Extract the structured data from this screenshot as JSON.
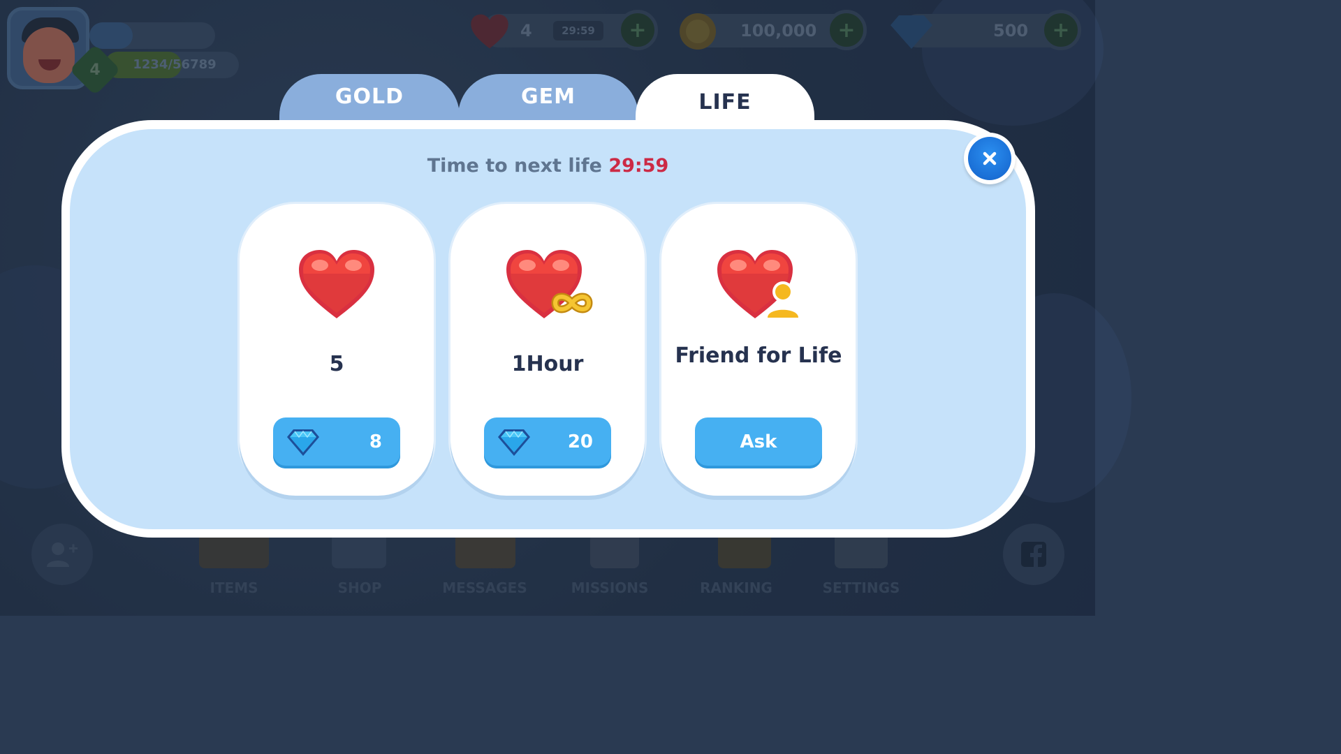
{
  "hud": {
    "player_level": "4",
    "xp_text": "1234/56789",
    "lives": {
      "count": "4",
      "timer": "29:59",
      "icon": "heart-icon"
    },
    "gold": {
      "amount": "100,000",
      "icon": "coin-icon"
    },
    "gems": {
      "amount": "500",
      "icon": "gem-icon"
    },
    "plus_label": "+"
  },
  "bottom_nav": {
    "items": [
      {
        "label": "ITEMS",
        "icon": "chest-icon"
      },
      {
        "label": "SHOP",
        "icon": "shop-icon"
      },
      {
        "label": "MESSAGES",
        "icon": "envelope-icon"
      },
      {
        "label": "MISSIONS",
        "icon": "scroll-icon"
      },
      {
        "label": "RANKING",
        "icon": "trophy-icon"
      },
      {
        "label": "SETTINGS",
        "icon": "gear-icon"
      }
    ],
    "add_friend_icon": "add-friend-icon",
    "facebook_icon": "facebook-icon"
  },
  "modal": {
    "tabs": [
      {
        "label": "GOLD",
        "active": false
      },
      {
        "label": "GEM",
        "active": false
      },
      {
        "label": "LIFE",
        "active": true
      }
    ],
    "timer_prefix": "Time to next life",
    "timer_value": "29:59",
    "close_icon": "close-icon",
    "cards": [
      {
        "title": "5",
        "price": "8",
        "icon": "heart-icon",
        "button_icon": "gem-icon"
      },
      {
        "title": "1Hour",
        "price": "20",
        "icon": "infinite-heart-icon",
        "button_icon": "gem-icon"
      },
      {
        "title": "Friend for Life",
        "button_label": "Ask",
        "icon": "friend-heart-icon"
      }
    ]
  },
  "colors": {
    "tab_inactive": "#8aaedc",
    "panel": "#c6e2fa",
    "button": "#46b0f2",
    "countdown": "#cc2a45",
    "heart": "#f0453f",
    "text_dark": "#26324f"
  }
}
